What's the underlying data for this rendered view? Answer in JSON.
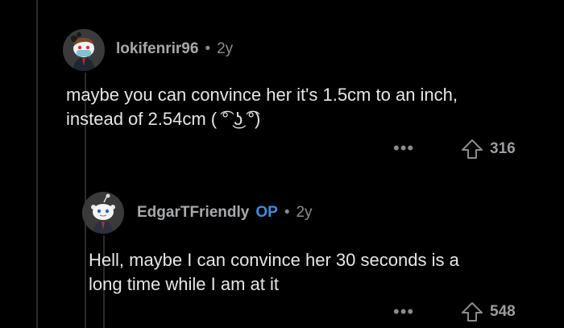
{
  "comments": [
    {
      "username": "lokifenrir96",
      "separator": "•",
      "age": "2y",
      "text_line1": "maybe you can convince her it's 1.5cm to an inch,",
      "text_line2": "instead of 2.54cm ( ͡° ͜ʖ ͡°)",
      "more_label": "•••",
      "upvotes": "316",
      "upvote_icon": "upvote-arrow-icon"
    },
    {
      "username": "EdgarTFriendly",
      "op_badge": "OP",
      "separator": "•",
      "age": "2y",
      "text_line1": "Hell, maybe I can convince her 30 seconds is a",
      "text_line2": "long time while I am at it",
      "more_label": "•••",
      "upvotes": "548",
      "upvote_icon": "upvote-arrow-icon"
    }
  ],
  "colors": {
    "background": "#000000",
    "username": "#a7a9ab",
    "op_badge": "#3d8ddd",
    "body_text": "#e6e6e6",
    "muted": "#8a8c8e",
    "thread_line": "#2b2b2b"
  }
}
